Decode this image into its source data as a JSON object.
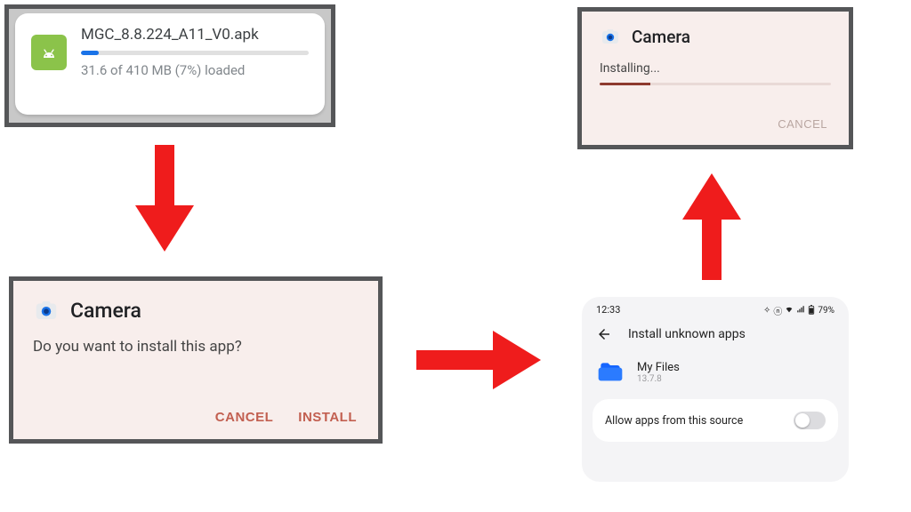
{
  "download": {
    "filename": "MGC_8.8.224_A11_V0.apk",
    "status": "31.6 of 410 MB (7%) loaded",
    "progress_percent": 7,
    "icon": "apk-icon"
  },
  "confirm": {
    "app_name": "Camera",
    "message": "Do you want to install this app?",
    "cancel_label": "CANCEL",
    "install_label": "INSTALL"
  },
  "installing": {
    "app_name": "Camera",
    "message": "Installing...",
    "cancel_label": "CANCEL",
    "progress_percent": 22
  },
  "settings": {
    "status_bar": {
      "time": "12:33",
      "battery": "79%"
    },
    "header_title": "Install unknown apps",
    "app": {
      "name": "My Files",
      "version": "13.7.8",
      "icon": "folder-icon"
    },
    "toggle_row": {
      "label": "Allow apps from this source",
      "enabled": false
    }
  }
}
